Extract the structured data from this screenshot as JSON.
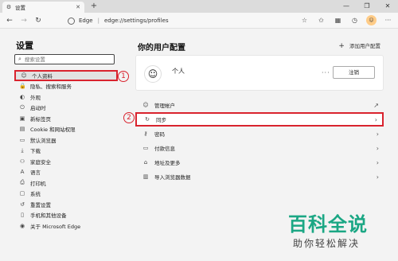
{
  "tab": {
    "title": "设置",
    "close": "✕"
  },
  "newtab": "+",
  "window_buttons": [
    "—",
    "❐",
    "✕"
  ],
  "address": {
    "brand": "Edge",
    "separator": "|",
    "url": "edge://settings/profiles"
  },
  "sidebar": {
    "title": "设置",
    "search_placeholder": "搜索设置",
    "items": [
      {
        "label": "个人资料",
        "icon": "profile-icon",
        "glyph": "☺"
      },
      {
        "label": "隐私、搜索和服务",
        "icon": "lock-icon",
        "glyph": "🔒"
      },
      {
        "label": "外观",
        "icon": "appearance-icon",
        "glyph": "◐"
      },
      {
        "label": "启动时",
        "icon": "power-icon",
        "glyph": "⏻"
      },
      {
        "label": "新标签页",
        "icon": "new-tab-icon",
        "glyph": "▣"
      },
      {
        "label": "Cookie 和网站权限",
        "icon": "site-permissions-icon",
        "glyph": "▤"
      },
      {
        "label": "默认浏览器",
        "icon": "browser-icon",
        "glyph": "▭"
      },
      {
        "label": "下载",
        "icon": "download-icon",
        "glyph": "⤓"
      },
      {
        "label": "家庭安全",
        "icon": "family-icon",
        "glyph": "⚇"
      },
      {
        "label": "语言",
        "icon": "language-icon",
        "glyph": "A"
      },
      {
        "label": "打印机",
        "icon": "printer-icon",
        "glyph": "⎙"
      },
      {
        "label": "系统",
        "icon": "system-icon",
        "glyph": "▢"
      },
      {
        "label": "重置设置",
        "icon": "reset-icon",
        "glyph": "↺"
      },
      {
        "label": "手机和其他设备",
        "icon": "phone-icon",
        "glyph": "▯"
      },
      {
        "label": "关于 Microsoft Edge",
        "icon": "edge-icon",
        "glyph": "◉"
      }
    ]
  },
  "main": {
    "title": "你的用户配置",
    "add_profile": "添加用户配置",
    "profile": {
      "name": "个人",
      "more": "···",
      "signout": "注销"
    },
    "items": [
      {
        "label": "管理帐户",
        "icon": "manage-account-icon",
        "glyph": "☺",
        "trail": "↗"
      },
      {
        "label": "同步",
        "icon": "sync-icon",
        "glyph": "↻",
        "trail": "›"
      },
      {
        "label": "密码",
        "icon": "key-icon",
        "glyph": "⚷",
        "trail": "›"
      },
      {
        "label": "付款信息",
        "icon": "card-icon",
        "glyph": "▭",
        "trail": "›"
      },
      {
        "label": "地址及更多",
        "icon": "address-icon",
        "glyph": "⌂",
        "trail": "›"
      },
      {
        "label": "导入浏览器数据",
        "icon": "import-icon",
        "glyph": "▥",
        "trail": "›"
      }
    ]
  },
  "annotations": {
    "one": "1",
    "two": "2"
  },
  "watermark": {
    "main": "百科全说",
    "sub": "助你轻松解决"
  },
  "colors": {
    "highlight": "#d9232e",
    "watermark": "#1ba784"
  }
}
